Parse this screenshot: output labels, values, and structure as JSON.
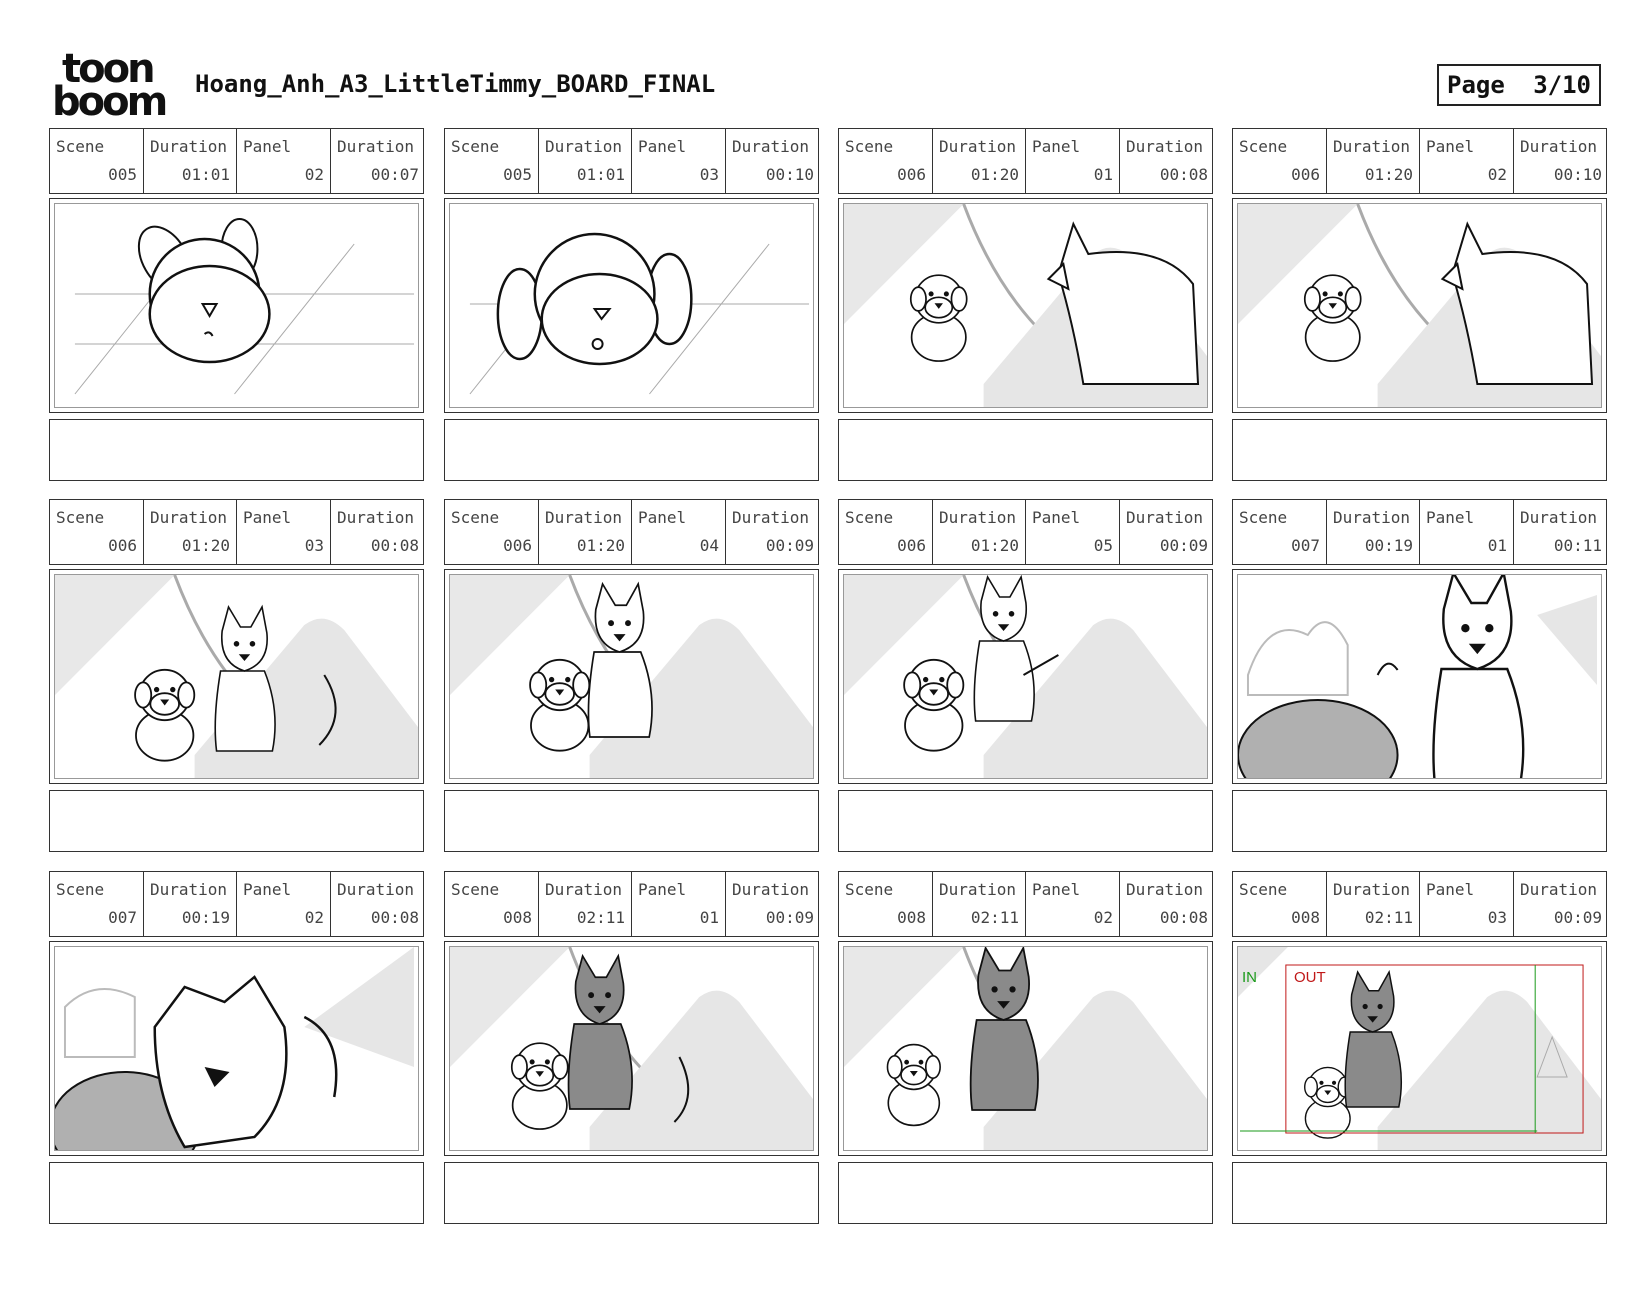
{
  "header": {
    "logo_line1": "toon",
    "logo_line2": "boom",
    "title": "Hoang_Anh_A3_LittleTimmy_BOARD_FINAL",
    "page_label": "Page",
    "page_value": "3/10"
  },
  "labels": {
    "scene": "Scene",
    "duration": "Duration",
    "panel": "Panel"
  },
  "panels": [
    {
      "scene": "005",
      "scene_duration": "01:01",
      "panel": "02",
      "panel_duration": "00:07",
      "art": "closeup-flat"
    },
    {
      "scene": "005",
      "scene_duration": "01:01",
      "panel": "03",
      "panel_duration": "00:10",
      "art": "closeup-floppy"
    },
    {
      "scene": "006",
      "scene_duration": "01:20",
      "panel": "01",
      "panel_duration": "00:08",
      "art": "pup-dog-walk"
    },
    {
      "scene": "006",
      "scene_duration": "01:20",
      "panel": "02",
      "panel_duration": "00:10",
      "art": "pup-dog-walk"
    },
    {
      "scene": "006",
      "scene_duration": "01:20",
      "panel": "03",
      "panel_duration": "00:08",
      "art": "pup-dog-sit"
    },
    {
      "scene": "006",
      "scene_duration": "01:20",
      "panel": "04",
      "panel_duration": "00:09",
      "art": "pup-dog-lean"
    },
    {
      "scene": "006",
      "scene_duration": "01:20",
      "panel": "05",
      "panel_duration": "00:09",
      "art": "pup-dog-point"
    },
    {
      "scene": "007",
      "scene_duration": "00:19",
      "panel": "01",
      "panel_duration": "00:11",
      "art": "fox-point"
    },
    {
      "scene": "007",
      "scene_duration": "00:19",
      "panel": "02",
      "panel_duration": "00:08",
      "art": "fox-snarl"
    },
    {
      "scene": "008",
      "scene_duration": "02:11",
      "panel": "01",
      "panel_duration": "00:09",
      "art": "pup-dark-dog"
    },
    {
      "scene": "008",
      "scene_duration": "02:11",
      "panel": "02",
      "panel_duration": "00:08",
      "art": "pup-dark-dog-stand"
    },
    {
      "scene": "008",
      "scene_duration": "02:11",
      "panel": "03",
      "panel_duration": "00:09",
      "art": "camera-move",
      "in_label": "IN",
      "out_label": "OUT"
    }
  ],
  "colors": {
    "in_marker": "#1a9a1a",
    "out_marker": "#c01818",
    "hill": "#e6e6e6",
    "dark_dog": "#8a8a8a"
  }
}
